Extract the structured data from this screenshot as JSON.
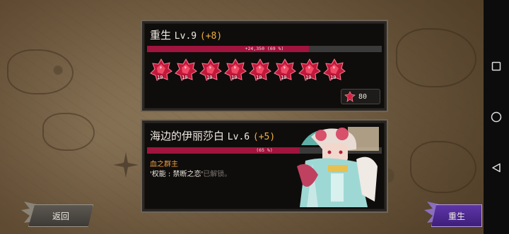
{
  "rebirth_panel": {
    "title": "重生",
    "level": "Lv.9",
    "bonus": "(+8)",
    "exp_text": "+24,350 (69 %)",
    "exp_progress": 0.69,
    "gems": [
      {
        "count": "10"
      },
      {
        "count": "10"
      },
      {
        "count": "10"
      },
      {
        "count": "10"
      },
      {
        "count": "10"
      },
      {
        "count": "10"
      },
      {
        "count": "10"
      },
      {
        "count": "10"
      }
    ],
    "cost": "80"
  },
  "character_panel": {
    "title": "海边的伊丽莎白",
    "level": "Lv.6",
    "bonus": "(+5)",
    "exp_text": "(65 %)",
    "exp_progress": 0.65,
    "subtitle": "血之群主",
    "ability_text": "'权能 : 禁断之恋'",
    "locked_text": "已解锁。"
  },
  "buttons": {
    "back": "返回",
    "rebirth": "重生"
  },
  "colors": {
    "exp_bar": "#a0143e",
    "bonus": "#f0b040",
    "rebirth_button": "#5f35a8"
  },
  "icons": {
    "gem": "red-gem-icon",
    "nav_recent": "square-icon",
    "nav_home": "circle-icon",
    "nav_back": "triangle-icon"
  }
}
